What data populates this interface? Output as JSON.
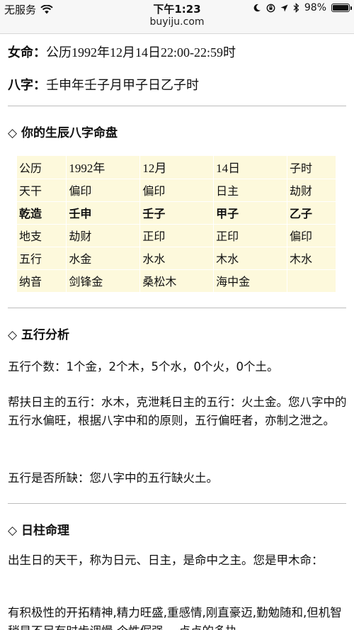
{
  "status_bar": {
    "carrier": "无服务",
    "time": "下午1:23",
    "url": "buyiju.com",
    "battery": "98%",
    "battery_level": 0.98
  },
  "profile": {
    "female_label": "女命：",
    "female_value": "公历1992年12月14日22:00-22:59时",
    "bazi_label": "八字：",
    "bazi_value": "壬申年壬子月甲子日乙子时"
  },
  "chart_section": {
    "title": "◇ 你的生辰八字命盘",
    "rows": [
      [
        "公历",
        "1992年",
        "12月",
        "14日",
        "子时"
      ],
      [
        "天干",
        "偏印",
        "偏印",
        "日主",
        "劫财"
      ],
      [
        "乾造",
        "壬申",
        "壬子",
        "甲子",
        "乙子"
      ],
      [
        "地支",
        "劫财",
        "正印",
        "正印",
        "偏印"
      ],
      [
        "五行",
        "水金",
        "水水",
        "木水",
        "木水"
      ],
      [
        "纳音",
        "剑锋金",
        "桑松木",
        "海中金",
        ""
      ]
    ]
  },
  "wuxing_section": {
    "title": "◇ 五行分析",
    "count_text": "五行个数：1个金，2个木，5个水，0个火，0个土。",
    "balance_text": "帮扶日主的五行：水木，克泄耗日主的五行：火土金。您八字中的五行水偏旺，根据八字中和的原则，五行偏旺者，亦制之泄之。",
    "lack_text": "五行是否所缺：您八字中的五行缺火土。"
  },
  "rizhu_section": {
    "title": "◇ 日柱命理",
    "intro_text": "出生日的天干，称为日元、日主，是命中之主。您是甲木命：",
    "trait_text": "有积极性的开拓精神,精力旺盛,重感情,刚直豪迈,勤勉随和,但机智稍显不足有时步调慢,个性倔强,一点点的多执"
  },
  "colors": {
    "table_bg": "#fdf9dc",
    "status_bg": "#f7f7f7",
    "divider": "#bdbdbd"
  }
}
